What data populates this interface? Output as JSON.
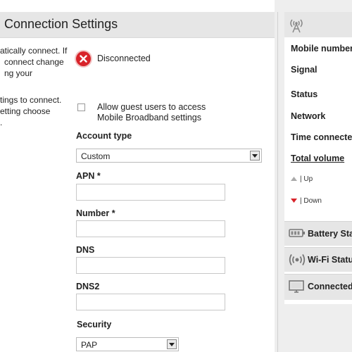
{
  "main": {
    "title": "Connection Settings",
    "left_text": {
      "line1": "atically connect. If",
      "line2": "connect change",
      "line3": "ng your",
      "line4": "tings to connect.",
      "line5": "etting choose"
    },
    "status": {
      "icon": "disconnected-x-icon",
      "text": "Disconnected",
      "color": "#d8232a"
    },
    "guest": {
      "line1": "Allow guest users to access",
      "line2": "Mobile Broadband settings"
    },
    "account_type": {
      "label": "Account type",
      "value": "Custom"
    },
    "apn": {
      "label": "APN *",
      "value": ""
    },
    "number": {
      "label": "Number *",
      "value": ""
    },
    "dns": {
      "label": "DNS",
      "value": ""
    },
    "dns2": {
      "label": "DNS2",
      "value": ""
    },
    "security": {
      "label": "Security",
      "value": "PAP"
    }
  },
  "sidebar": {
    "header_icon": "antenna-icon",
    "rows": {
      "mobile_number": "Mobile number",
      "signal": "Signal",
      "status": "Status",
      "network": "Network",
      "time_connected": "Time connected",
      "total_volume": "Total volume",
      "up": "| Up",
      "down": "| Down"
    },
    "panels": {
      "battery": {
        "label": "Battery Sta",
        "icon": "battery-icon"
      },
      "wifi": {
        "label": "Wi-Fi Status",
        "icon": "wifi-icon"
      },
      "connected": {
        "label": "Connected",
        "icon": "monitor-icon"
      }
    }
  },
  "colors": {
    "accent_red": "#d8232a",
    "panel_bg": "#e6e6e6",
    "page_bg": "#eeeeee"
  }
}
